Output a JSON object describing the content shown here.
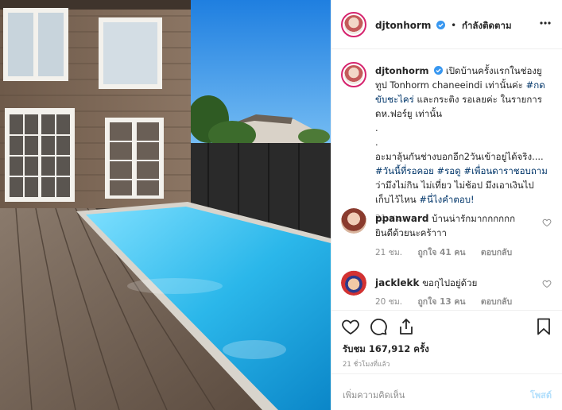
{
  "photo": {
    "description_icon": "pool-house-photo"
  },
  "header": {
    "username": "djtonhorm",
    "verified_icon": "verified-badge-icon",
    "dot": "•",
    "follow_status": "กำลังติดตาม",
    "more_icon": "more-options-icon"
  },
  "caption": {
    "username": "djtonhorm",
    "text_lines": [
      "เปิดบ้านครั้งแรกในช่องยู",
      "ทูป Tonhorm chaneeindi เท่านั้นค่ะ",
      "และกระติง รอเลยค่ะ ในรายการ",
      "ดห.ฟอร์ยู เท่านั้น",
      ".",
      ".",
      "อะมาลุ้นกันช่างบอกอีก2วันเข้าอยู่ได้จริง....",
      "ว่ามึงไม่กิน ไม่เที่ยว ไม่ช้อป มึงเอาเงินไป",
      "เก็บไว้ไหน"
    ],
    "hashtags": {
      "h1": "#กด",
      "h2": "ขับชะไคร่",
      "h3": "#วันนี้ที่รอคอย",
      "h4": "#รอดู",
      "h5": "#เพื่อนดาราชอบถาม",
      "h6": "#นี่ไงคำตอบ!"
    },
    "time": "21 ชม."
  },
  "comments": [
    {
      "username": "ppanward",
      "text_a": "บ้านน่ารักมากกกกกก",
      "text_b": "ยินดีด้วยนะคร้าาา",
      "time": "21 ชม.",
      "likes": "ถูกใจ 41 คน",
      "reply": "ตอบกลับ"
    },
    {
      "username": "jacklekk",
      "text_a": "ขอกุไปอยู่ด้วย",
      "time": "20 ชม.",
      "likes": "ถูกใจ 13 คน",
      "reply": "ตอบกลับ"
    }
  ],
  "actions": {
    "like_icon": "heart-icon",
    "comment_icon": "comment-icon",
    "share_icon": "share-icon",
    "save_icon": "bookmark-icon",
    "views": "รับชม 167,912 ครั้ง",
    "posted_time": "21 ชั่วโมงที่แล้ว"
  },
  "add_comment": {
    "placeholder": "เพิ่มความคิดเห็น",
    "post_label": "โพสต์"
  },
  "colors": {
    "hashtag": "#003569",
    "verified": "#3897f0",
    "story_ring": "#d6246e",
    "post_button_disabled": "#b2dffc"
  }
}
